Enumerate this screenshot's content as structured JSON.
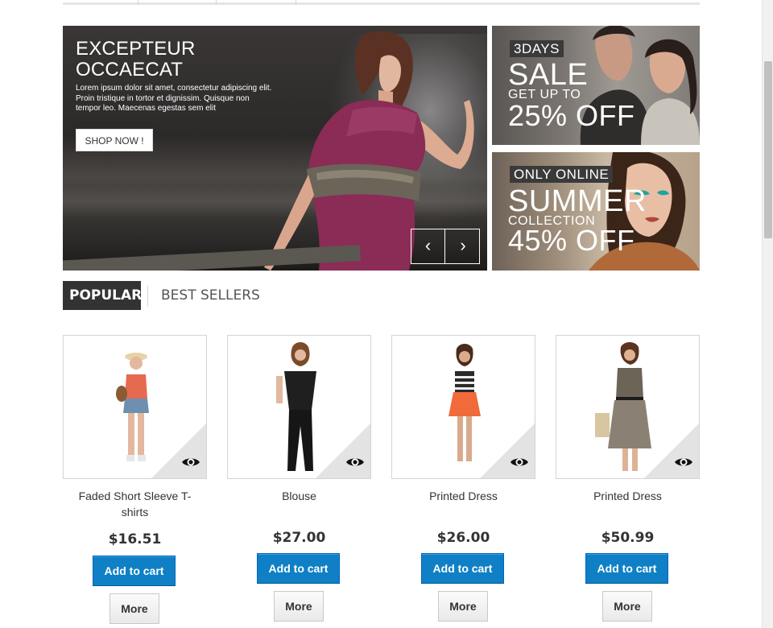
{
  "hero": {
    "title_line1": "EXCEPTEUR",
    "title_line2": "OCCAECAT",
    "text_lines": [
      "Lorem ipsum dolor sit amet, consectetur adipiscing elit.",
      "Proin tristique in tortor et dignissim. Quisque non",
      "tempor leo. Maecenas egestas sem elit"
    ],
    "button": "SHOP NOW !",
    "prev_icon": "‹",
    "next_icon": "›"
  },
  "promos": [
    {
      "tag": "3DAYS",
      "big": "SALE",
      "small": "GET UP TO",
      "pct": "25% OFF"
    },
    {
      "tag": "ONLY ONLINE",
      "big": "SUMMER",
      "small": "COLLECTION",
      "pct": "45% OFF"
    }
  ],
  "tabs": {
    "popular": "POPULAR",
    "best_sellers": "BEST SELLERS"
  },
  "products": [
    {
      "name": "Faded Short Sleeve T-shirts",
      "price": "$16.51",
      "cart": "Add to cart",
      "more": "More"
    },
    {
      "name": "Blouse",
      "price": "$27.00",
      "cart": "Add to cart",
      "more": "More"
    },
    {
      "name": "Printed Dress",
      "price": "$26.00",
      "cart": "Add to cart",
      "more": "More"
    },
    {
      "name": "Printed Dress",
      "price": "$50.99",
      "cart": "Add to cart",
      "more": "More"
    }
  ],
  "colors": {
    "accent": "#0f80c6",
    "tab_active": "#333333"
  }
}
